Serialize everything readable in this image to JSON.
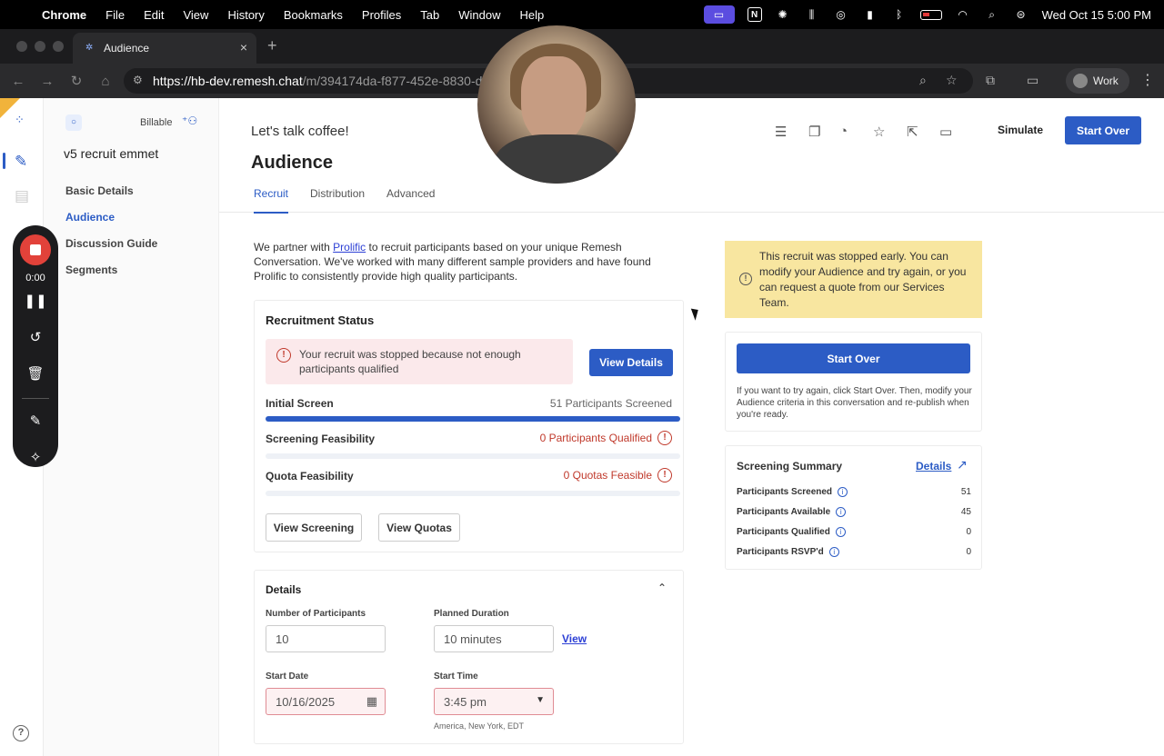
{
  "menubar": {
    "apple": "",
    "items": [
      "Chrome",
      "File",
      "Edit",
      "View",
      "History",
      "Bookmarks",
      "Profiles",
      "Tab",
      "Window",
      "Help"
    ],
    "clock": "Wed Oct 15  5:00 PM",
    "n_label": "N"
  },
  "browser": {
    "tab_title": "Audience",
    "url_host": "https://hb-dev.remesh.chat",
    "url_path": "/m/394174da-f877-452e-8830-d54",
    "profile": "Work"
  },
  "recorder": {
    "time": "0:00"
  },
  "sidebar": {
    "billable": "Billable",
    "project": "v5 recruit emmet",
    "items": [
      {
        "label": "Basic Details",
        "active": false
      },
      {
        "label": "Audience",
        "active": true
      },
      {
        "label": "Discussion Guide",
        "active": false
      },
      {
        "label": "Segments",
        "active": false
      }
    ]
  },
  "header": {
    "conversation": "Let's talk coffee!",
    "title": "Audience",
    "tabs": [
      "Recruit",
      "Distribution",
      "Advanced"
    ],
    "simulate": "Simulate",
    "start_over": "Start Over"
  },
  "intro": {
    "pre": "We partner with ",
    "link": "Prolific",
    "post": " to recruit participants based on your unique Remesh Conversation. We've worked with many different sample providers and have found Prolific to consistently provide high quality participants."
  },
  "recruitment": {
    "title": "Recruitment Status",
    "alert": "Your recruit was stopped because not enough participants qualified",
    "view_details": "View Details",
    "initial_screen_label": "Initial Screen",
    "initial_screen_value": "51 Participants Screened",
    "initial_screen_progress": 1.0,
    "screening_label": "Screening Feasibility",
    "screening_value": "0 Participants Qualified",
    "quota_label": "Quota Feasibility",
    "quota_value": "0 Quotas Feasible",
    "view_screening": "View Screening",
    "view_quotas": "View Quotas"
  },
  "details": {
    "title": "Details",
    "num_participants_label": "Number of Participants",
    "num_participants": "10",
    "duration_label": "Planned Duration",
    "duration": "10 minutes",
    "view": "View",
    "start_date_label": "Start Date",
    "start_date": "10/16/2025",
    "start_time_label": "Start Time",
    "start_time": "3:45 pm",
    "timezone": "America, New York, EDT"
  },
  "notice": {
    "text": "This recruit was stopped early. You can modify your Audience and try again, or you can request a quote from our Services Team."
  },
  "start_over_card": {
    "button": "Start Over",
    "help": "If you want to try again, click Start Over. Then, modify your Audience criteria in this conversation and re-publish when you're ready."
  },
  "summary": {
    "title": "Screening Summary",
    "details": "Details",
    "rows": [
      {
        "label": "Participants Screened",
        "value": "51"
      },
      {
        "label": "Participants Available",
        "value": "45"
      },
      {
        "label": "Participants Qualified",
        "value": "0"
      },
      {
        "label": "Participants RSVP'd",
        "value": "0"
      }
    ]
  },
  "colors": {
    "accent": "#2c5cc5",
    "alert_red": "#c0392b",
    "notice_yellow": "#f8e6a0"
  }
}
